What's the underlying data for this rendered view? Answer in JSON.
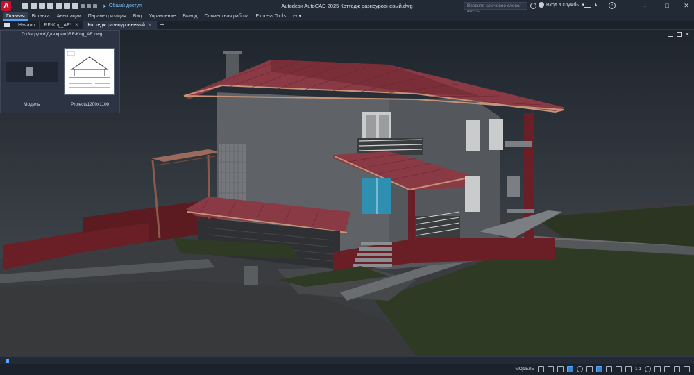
{
  "app": {
    "logo": "A",
    "title": "Autodesk AutoCAD 2025    Коттедж разноуровневый.dwg",
    "share_label": "Общий доступ"
  },
  "search": {
    "placeholder": "Введите ключевое слово/фразу"
  },
  "user": {
    "sign_in": "Вход в службы"
  },
  "ribbon_tabs": [
    "Главная",
    "Вставка",
    "Аннотации",
    "Параметризация",
    "Вид",
    "Управление",
    "Вывод",
    "Совместная работа",
    "Express Tools"
  ],
  "doc_tabs": [
    {
      "label": "Начало",
      "closable": false
    },
    {
      "label": "RF-Kng_AE*",
      "closable": true
    },
    {
      "label": "Коттедж разноуровневый",
      "closable": true
    }
  ],
  "layout_popup": {
    "path": "D:\\Загрузки\\Для крыш\\RF-Kng_AE.dwg",
    "model_label": "Модель",
    "layout_label": "Projects1200x1100"
  },
  "status": {
    "mode": "МОДЕЛЬ",
    "scale": "1:1"
  },
  "colors": {
    "accent": "#4da3ff",
    "roof": "#8a3a45",
    "wall": "#5f6266",
    "fence": "#6a1f26",
    "grass": "#2e3a24"
  }
}
